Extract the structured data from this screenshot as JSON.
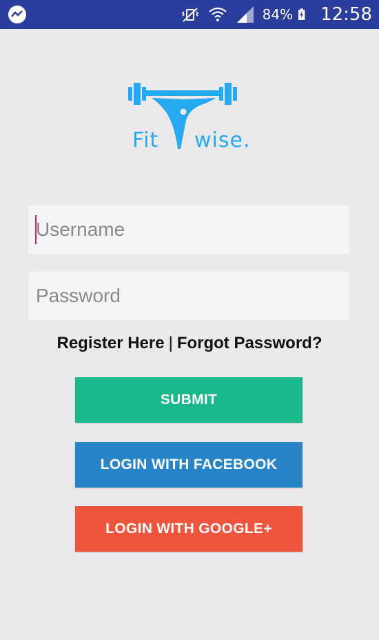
{
  "status_bar": {
    "battery": "84%",
    "time": "12:58",
    "left_icon": "messenger-icon",
    "icons": [
      "vibrate-icon",
      "wifi-icon",
      "signal-icon",
      "battery-charging-icon"
    ],
    "color": "#2a3c9c"
  },
  "logo": {
    "text_left": "Fit",
    "text_right": "wise.",
    "color": "#25a9f0",
    "icon": "barbell-figure-icon"
  },
  "form": {
    "username_placeholder": "Username",
    "username_value": "",
    "password_placeholder": "Password",
    "password_value": ""
  },
  "links": {
    "register": "Register Here",
    "separator": "|",
    "forgot": "Forgot Password?"
  },
  "buttons": {
    "submit": "SUBMIT",
    "facebook": "LOGIN WITH FACEBOOK",
    "google": "LOGIN WITH GOOGLE+"
  },
  "colors": {
    "submit": "#1ab98b",
    "facebook": "#2a85c6",
    "google": "#ee553c",
    "background": "#ebe9ec"
  }
}
